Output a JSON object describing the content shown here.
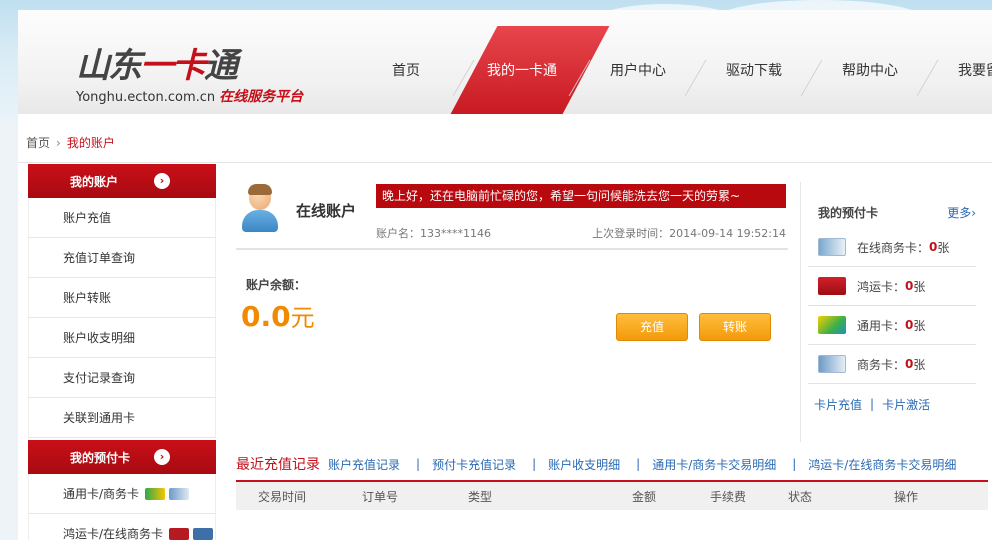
{
  "logo": {
    "title_a": "山东",
    "title_b": "一卡",
    "title_c": "通",
    "url": "Yonghu.ecton.com.cn",
    "tagline": "在线服务平台"
  },
  "nav": [
    "首页",
    "我的一卡通",
    "用户中心",
    "驱动下载",
    "帮助中心",
    "我要留言"
  ],
  "breadcrumb": {
    "home": "首页",
    "current": "我的账户"
  },
  "sidebar": {
    "account_head": "我的账户",
    "account_items": [
      "账户充值",
      "充值订单查询",
      "账户转账",
      "账户收支明细",
      "支付记录查询",
      "关联到通用卡"
    ],
    "cards_head": "我的预付卡",
    "card_items": [
      "通用卡/商务卡",
      "鸿运卡/在线商务卡"
    ]
  },
  "account": {
    "title": "在线账户",
    "greeting": "晚上好，还在电脑前忙碌的您，希望一句问候能洗去您一天的劳累~",
    "name": "账户名：133****1146",
    "last_login": "上次登录时间：2014-09-14 19:52:14",
    "balance_label": "账户余额：",
    "balance": "0.0",
    "balance_unit": "元",
    "recharge_btn": "充值",
    "transfer_btn": "转账"
  },
  "prepaid": {
    "title": "我的预付卡",
    "more": "更多›",
    "rows": [
      {
        "label": "在线商务卡：",
        "count": "0",
        "unit": "张"
      },
      {
        "label": "鸿运卡：",
        "count": "0",
        "unit": "张"
      },
      {
        "label": "通用卡：",
        "count": "0",
        "unit": "张"
      },
      {
        "label": "商务卡：",
        "count": "0",
        "unit": "张"
      }
    ],
    "link_recharge": "卡片充值",
    "link_activate": "卡片激活"
  },
  "records": {
    "title": "最近充值记录",
    "tabs": [
      "账户充值记录",
      "预付卡充值记录",
      "账户收支明细",
      "通用卡/商务卡交易明细",
      "鸿运卡/在线商务卡交易明细"
    ],
    "columns": [
      "交易时间",
      "订单号",
      "类型",
      "金额",
      "手续费",
      "状态",
      "操作"
    ]
  }
}
